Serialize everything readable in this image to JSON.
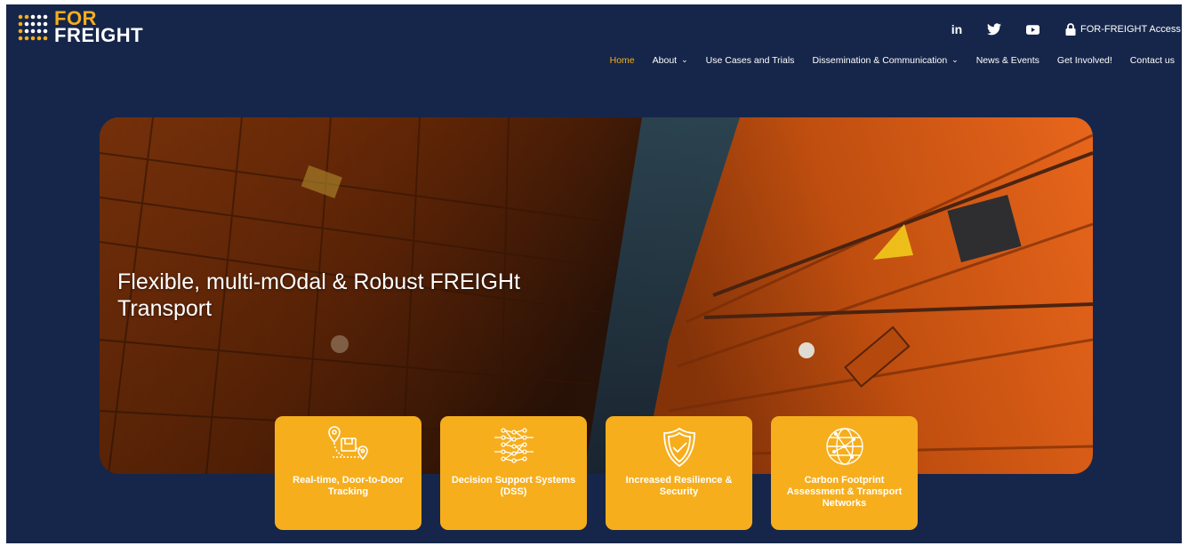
{
  "brand": {
    "logo_line1": "FOR",
    "logo_line2": "FREIGHT",
    "accent_color": "#f6ae1d",
    "background_color": "#16264a"
  },
  "social": {
    "linkedin_label": "in",
    "icons": [
      "linkedin-icon",
      "twitter-icon",
      "youtube-icon",
      "lock-icon"
    ]
  },
  "access": {
    "label": "FOR-FREIGHT Access"
  },
  "nav": {
    "home": "Home",
    "about": "About",
    "use_cases": "Use Cases and Trials",
    "dissemination": "Dissemination & Communication",
    "news": "News & Events",
    "get_involved": "Get Involved!",
    "contact": "Contact us",
    "active": "Home"
  },
  "hero": {
    "title": "Flexible, multi-mOdal & Robust FREIGHt Transport"
  },
  "features": [
    {
      "label": "Real-time, Door-to-Door Tracking",
      "icon": "tracking-route-icon"
    },
    {
      "label": "Decision Support Systems (DSS)",
      "icon": "network-brain-icon"
    },
    {
      "label": "Increased Resilience & Security",
      "icon": "shield-check-icon"
    },
    {
      "label": "Carbon Footprint Assessment & Transport Networks",
      "icon": "globe-network-icon"
    }
  ]
}
